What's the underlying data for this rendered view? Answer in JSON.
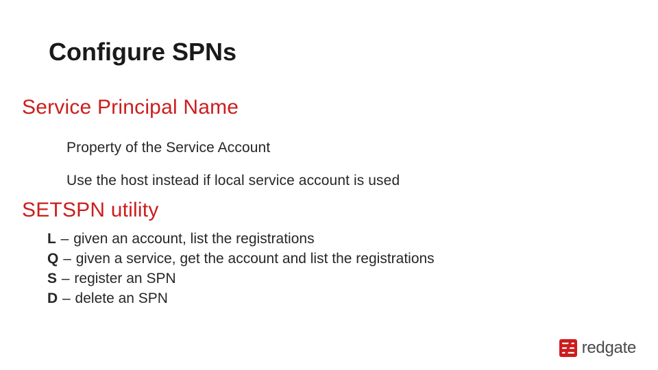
{
  "title": "Configure SPNs",
  "sections": {
    "spn": {
      "heading": "Service Principal Name",
      "lines": [
        "Property of the Service Account",
        "Use the host instead if local service account is used"
      ]
    },
    "setspn": {
      "heading": "SETSPN utility",
      "options": [
        {
          "flag": "L",
          "desc": "given an account, list the registrations"
        },
        {
          "flag": "Q",
          "desc": "given a service, get the account and list the registrations"
        },
        {
          "flag": "S",
          "desc": "register an SPN"
        },
        {
          "flag": "D",
          "desc": "delete an SPN"
        }
      ]
    }
  },
  "logo": {
    "text": "redgate"
  },
  "dash": "–"
}
